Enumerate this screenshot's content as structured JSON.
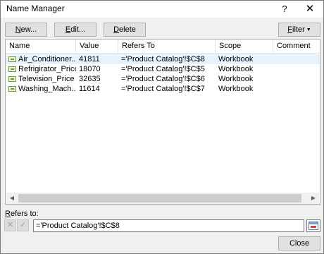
{
  "window": {
    "title": "Name Manager",
    "help_glyph": "?",
    "close_glyph": "✕"
  },
  "toolbar": {
    "new_label_ul": "N",
    "new_label_rest": "ew...",
    "edit_label_ul": "E",
    "edit_label_rest": "dit...",
    "delete_label_ul": "D",
    "delete_label_rest": "elete",
    "filter_label_ul": "F",
    "filter_label_rest": "ilter",
    "filter_arrow": "▼"
  },
  "table": {
    "columns": {
      "name": "Name",
      "value": "Value",
      "refers_to": "Refers To",
      "scope": "Scope",
      "comment": "Comment"
    },
    "rows": [
      {
        "name": "Air_Conditioner...",
        "value": "41811",
        "refers_to": "='Product Catalog'!$C$8",
        "scope": "Workbook",
        "comment": ""
      },
      {
        "name": "Refrigirator_Price",
        "value": "18070",
        "refers_to": "='Product Catalog'!$C$5",
        "scope": "Workbook",
        "comment": ""
      },
      {
        "name": "Television_Price",
        "value": "32635",
        "refers_to": "='Product Catalog'!$C$6",
        "scope": "Workbook",
        "comment": ""
      },
      {
        "name": "Washing_Mach...",
        "value": "11614",
        "refers_to": "='Product Catalog'!$C$7",
        "scope": "Workbook",
        "comment": ""
      }
    ],
    "selected_row": 0,
    "scroll_left_glyph": "◀",
    "scroll_right_glyph": "▶"
  },
  "refers_to": {
    "label_ul": "R",
    "label_rest": "efers to:",
    "value": "='Product Catalog'!$C$8",
    "cancel_glyph": "✕",
    "ok_glyph": "✓"
  },
  "footer": {
    "close_label": "Close"
  }
}
